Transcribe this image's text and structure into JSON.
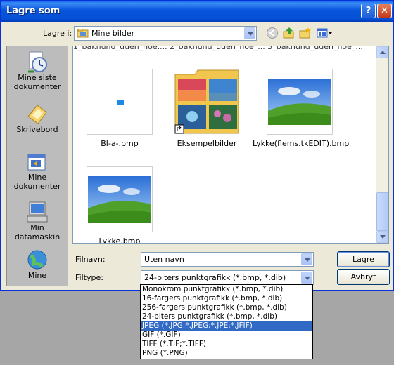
{
  "window": {
    "title": "Lagre som",
    "help_label": "?",
    "close_label": "✕"
  },
  "toolbar": {
    "lookin_label": "Lagre i:",
    "lookin_value": "Mine bilder",
    "icons": [
      "back-icon",
      "up-folder-icon",
      "new-folder-icon",
      "view-menu-icon"
    ]
  },
  "places": [
    {
      "label": "Mine siste dokumenter",
      "icon": "recent-documents-icon"
    },
    {
      "label": "Skrivebord",
      "icon": "desktop-icon"
    },
    {
      "label": "Mine dokumenter",
      "icon": "my-documents-icon"
    },
    {
      "label": "Min datamaskin",
      "icon": "my-computer-icon"
    },
    {
      "label": "Mine",
      "icon": "network-places-icon"
    }
  ],
  "files": {
    "cut_row_text": "1_bakhund_uden_noe.... 2_bakhund_uden_noe_... 3_bakhund_uden_noe_...",
    "items": [
      {
        "name": "Bl-a-.bmp"
      },
      {
        "name": "Eksempelbilder"
      },
      {
        "name": "Lykke(flems.tkEDIT).bmp"
      },
      {
        "name": "Lykke.bmp"
      }
    ]
  },
  "form": {
    "filename_label": "Filnavn:",
    "filename_value": "Uten navn",
    "filetype_label": "Filtype:",
    "filetype_value": "24-biters punktgrafikk (*.bmp, *.dib)",
    "save_button": "Lagre",
    "cancel_button": "Avbryt"
  },
  "filetype_options": [
    "Monokrom punktgrafikk (*.bmp, *.dib)",
    "16-fargers punktgrafikk (*.bmp, *.dib)",
    "256-fargers punktgrafikk (*.bmp, *.dib)",
    "24-biters punktgrafikk (*.bmp, *.dib)",
    "JPEG (*.JPG;*.JPEG;*.JPE;*.JFIF)",
    "GIF (*.GIF)",
    "TIFF (*.TIF;*.TIFF)",
    "PNG (*.PNG)"
  ],
  "selected_option_index": 4,
  "colors": {
    "titlebar": "#0855dd",
    "selection": "#316ac5",
    "dialog_bg": "#ece9d8"
  }
}
